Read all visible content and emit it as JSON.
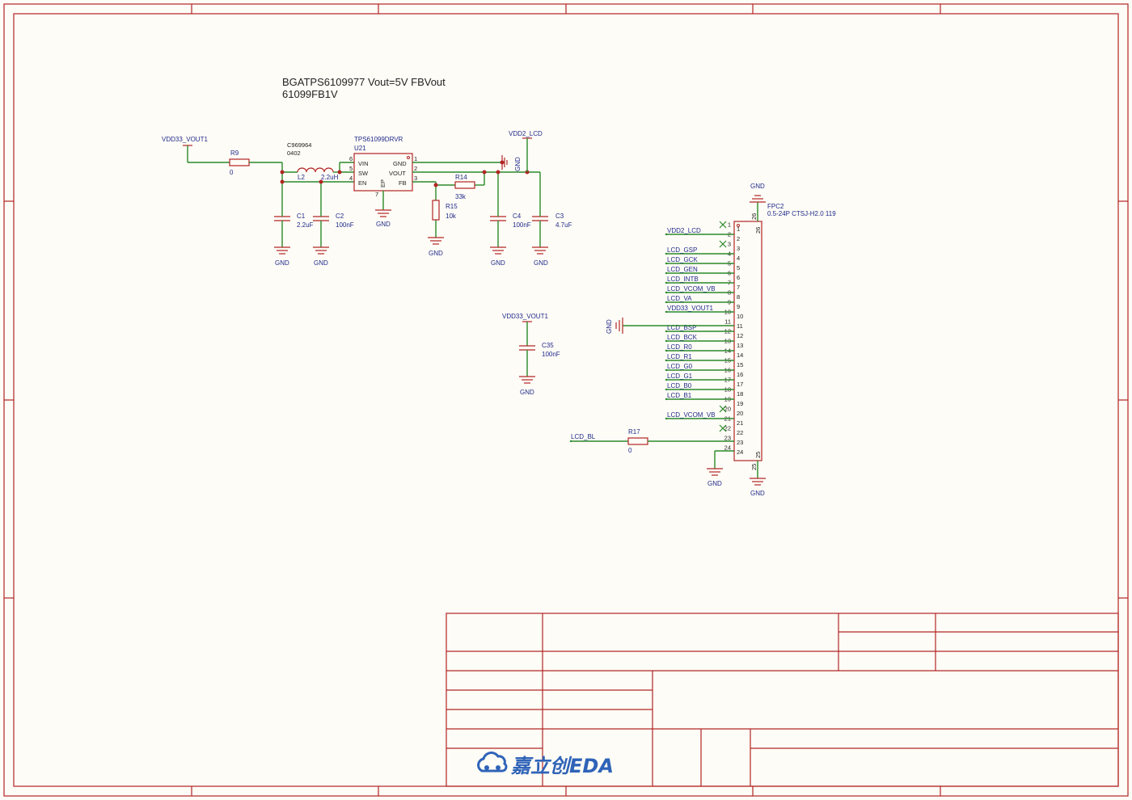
{
  "title": {
    "line1": "BGATPS6109977 Vout=5V FBVout",
    "line2": "61099FB1V"
  },
  "nets": {
    "vdd33_a": "VDD33_VOUT1",
    "vdd33_b": "VDD33_VOUT1",
    "vdd2": "VDD2_LCD",
    "gnd": "GND",
    "lcd_bl": "LCD_BL"
  },
  "u21": {
    "ref": "U21",
    "value": "TPS61099DRVR",
    "pins": {
      "vin": "VIN",
      "sw": "SW",
      "en": "EN",
      "gnd": "GND",
      "vout": "VOUT",
      "fb": "FB",
      "ep": "EP"
    }
  },
  "r9": {
    "ref": "R9",
    "value": "0"
  },
  "l2": {
    "ref": "L2",
    "value": "2.2uH",
    "part": "C969964",
    "pkg": "0402"
  },
  "c1": {
    "ref": "C1",
    "value": "2.2uF"
  },
  "c2": {
    "ref": "C2",
    "value": "100nF"
  },
  "r14": {
    "ref": "R14",
    "value": "33k"
  },
  "r15": {
    "ref": "R15",
    "value": "10k"
  },
  "c4": {
    "ref": "C4",
    "value": "100nF"
  },
  "c3": {
    "ref": "C3",
    "value": "4.7uF"
  },
  "c35": {
    "ref": "C35",
    "value": "100nF"
  },
  "r17": {
    "ref": "R17",
    "value": "0"
  },
  "fpc2": {
    "ref": "FPC2",
    "value": "0.5-24P CTSJ-H2.0 119"
  },
  "fpc_nets": [
    "",
    "",
    "VDD2_LCD",
    "",
    "LCD_GSP",
    "LCD_GCK",
    "LCD_GEN",
    "LCD_INTB",
    "LCD_VCOM_VB",
    "LCD_VA",
    "VDD33_VOUT1",
    "",
    "LCD_BSP",
    "LCD_BCK",
    "LCD_R0",
    "LCD_R1",
    "LCD_G0",
    "LCD_G1",
    "LCD_B0",
    "LCD_B1",
    "",
    "LCD_VCOM_VB",
    "",
    "",
    ""
  ],
  "logo": "嘉立创EDA"
}
